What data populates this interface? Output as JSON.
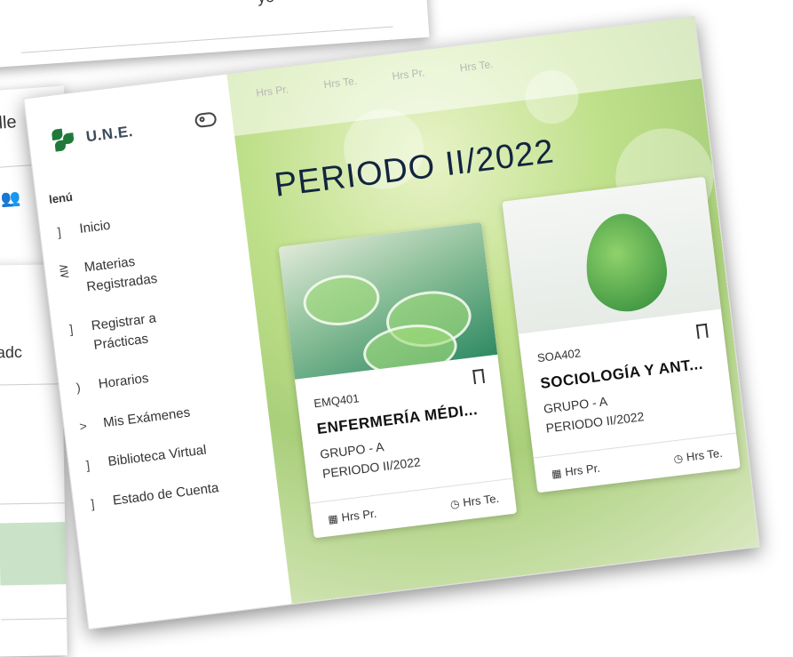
{
  "background": {
    "top_fragment": "yo",
    "left_fragment": "lle",
    "left_icon": "people-icon",
    "bottom_fragment": "adc"
  },
  "app": {
    "brand": "U.N.E.",
    "menu_heading": "lenú",
    "menu": [
      {
        "label": "Inicio",
        "icon": "]"
      },
      {
        "label": "Materias Registradas",
        "icon": "⋛"
      },
      {
        "label": "Registrar a Prácticas",
        "icon": "]"
      },
      {
        "label": "Horarios",
        "icon": ")"
      },
      {
        "label": "Mis Exámenes",
        "icon": ">"
      },
      {
        "label": "Biblioteca Virtual",
        "icon": "]"
      },
      {
        "label": "Estado de Cuenta",
        "icon": "]"
      }
    ]
  },
  "content": {
    "stats_strip": [
      "Hrs Pr.",
      "Hrs Te.",
      "Hrs Pr.",
      "Hrs Te."
    ],
    "period_title": "PERIODO II/2022",
    "cards": [
      {
        "code": "EMQ401",
        "course": "ENFERMERÍA MÉDI...",
        "group": "GRUPO - A",
        "period": "PERIODO II/2022",
        "hrs_pr": "Hrs Pr.",
        "hrs_te": "Hrs Te."
      },
      {
        "code": "SOA402",
        "course": "SOCIOLOGÍA Y ANT...",
        "group": "GRUPO - A",
        "period": "PERIODO II/2022",
        "hrs_pr": "Hrs Pr.",
        "hrs_te": "Hrs Te."
      }
    ]
  }
}
